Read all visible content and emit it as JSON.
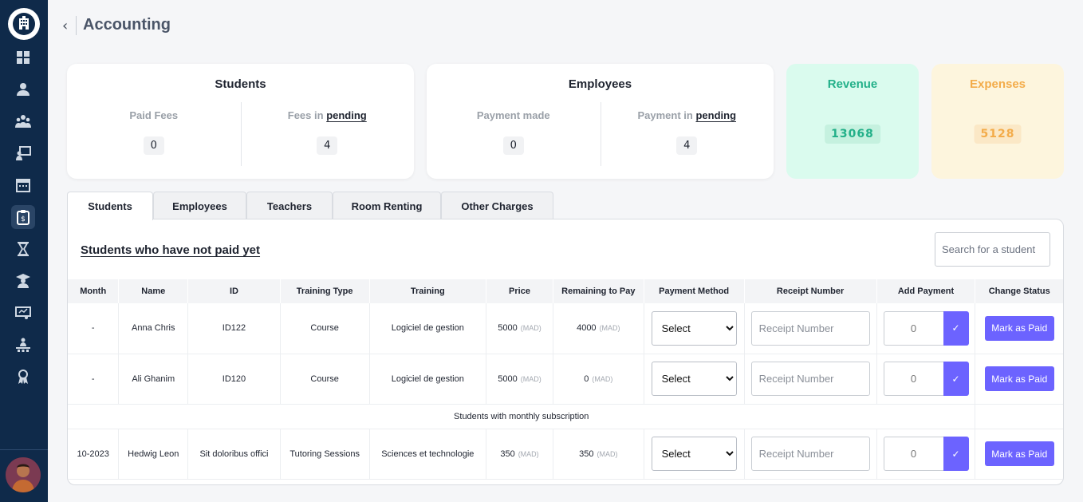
{
  "header": {
    "back_icon": "chevron-left-icon",
    "title": "Accounting"
  },
  "sidebar": {
    "icons": [
      "dashboard-icon",
      "user-icon",
      "users-group-icon",
      "teacher-board-icon",
      "calendar-icon",
      "accounting-clipboard-icon",
      "hourglass-icon",
      "graduate-icon",
      "presentation-icon",
      "classroom-icon",
      "certificate-badge-icon"
    ],
    "active_index": 5
  },
  "cards": {
    "students": {
      "title": "Students",
      "left_label": "Paid Fees",
      "left_value": "0",
      "right_label_prefix": "Fees in",
      "right_label_emph": "pending",
      "right_value": "4"
    },
    "employees": {
      "title": "Employees",
      "left_label": "Payment made",
      "left_value": "0",
      "right_label_prefix": "Payment in",
      "right_label_emph": "pending",
      "right_value": "4"
    },
    "revenue": {
      "title": "Revenue",
      "value": "13068",
      "color": "#23b089",
      "bg": "#dafbee"
    },
    "expenses": {
      "title": "Expenses",
      "value": "5128",
      "color": "#f3ac4a",
      "bg": "#fdf5dd"
    }
  },
  "tabs": [
    "Students",
    "Employees",
    "Teachers",
    "Room Renting",
    "Other Charges"
  ],
  "panel": {
    "title": "Students who have not paid yet",
    "search_placeholder": "Search for a student"
  },
  "table": {
    "columns": [
      "Month",
      "Name",
      "ID",
      "Training Type",
      "Training",
      "Price",
      "Remaining to Pay",
      "Payment Method",
      "Receipt Number",
      "Add Payment",
      "Change Status"
    ],
    "unit": "(MAD)",
    "select_label": "Select",
    "receipt_placeholder": "Receipt Number",
    "add_payment_value": "0",
    "mark_label": "Mark as Paid",
    "section_label": "Students with monthly subscription",
    "rows": [
      {
        "month": "-",
        "name": "Anna Chris",
        "id": "ID122",
        "training_type": "Course",
        "training": "Logiciel de gestion",
        "price": "5000",
        "remaining": "4000"
      },
      {
        "month": "-",
        "name": "Ali Ghanim",
        "id": "ID120",
        "training_type": "Course",
        "training": "Logiciel de gestion",
        "price": "5000",
        "remaining": "0"
      },
      {
        "month": "10-2023",
        "name": "Hedwig Leon",
        "id": "Sit doloribus offici",
        "training_type": "Tutoring Sessions",
        "training": "Sciences et technologie",
        "price": "350",
        "remaining": "350"
      }
    ]
  }
}
